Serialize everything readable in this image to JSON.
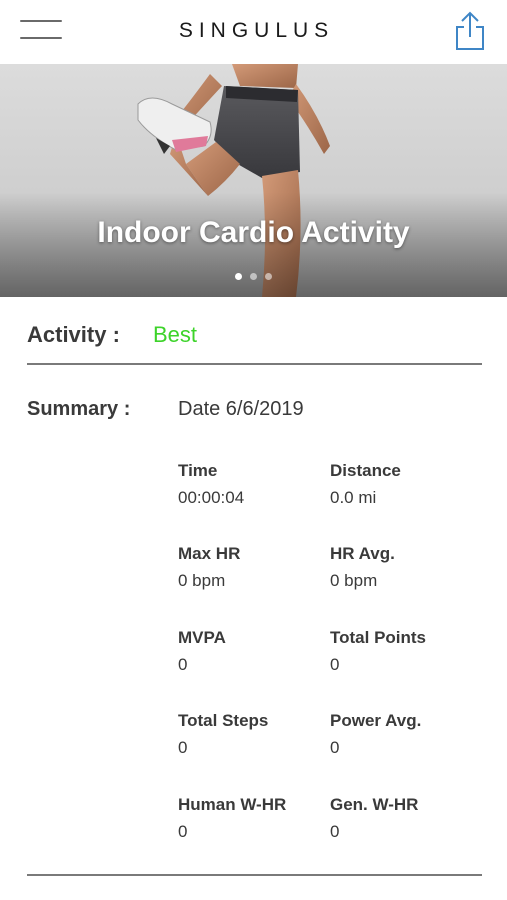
{
  "header": {
    "brand": "SINGULUS",
    "menu_icon": "hamburger-menu-icon",
    "share_icon": "share-icon"
  },
  "hero": {
    "title": "Indoor Cardio Activity",
    "slide_count": 3,
    "active_slide": 1
  },
  "activity": {
    "label": "Activity :",
    "value": "Best",
    "value_color": "#3dd32a"
  },
  "summary": {
    "label": "Summary :",
    "date": "Date 6/6/2019",
    "stats": [
      {
        "label": "Time",
        "value": "00:00:04"
      },
      {
        "label": "Distance",
        "value": "0.0 mi"
      },
      {
        "label": "Max HR",
        "value": "0 bpm"
      },
      {
        "label": "HR Avg.",
        "value": "0 bpm"
      },
      {
        "label": "MVPA",
        "value": "0"
      },
      {
        "label": "Total Points",
        "value": "0"
      },
      {
        "label": "Total Steps",
        "value": "0"
      },
      {
        "label": "Power Avg.",
        "value": "0"
      },
      {
        "label": "Human W-HR",
        "value": "0"
      },
      {
        "label": "Gen. W-HR",
        "value": "0"
      }
    ]
  },
  "colors": {
    "accent_blue": "#3f86c6",
    "divider": "#7a7a7a"
  }
}
